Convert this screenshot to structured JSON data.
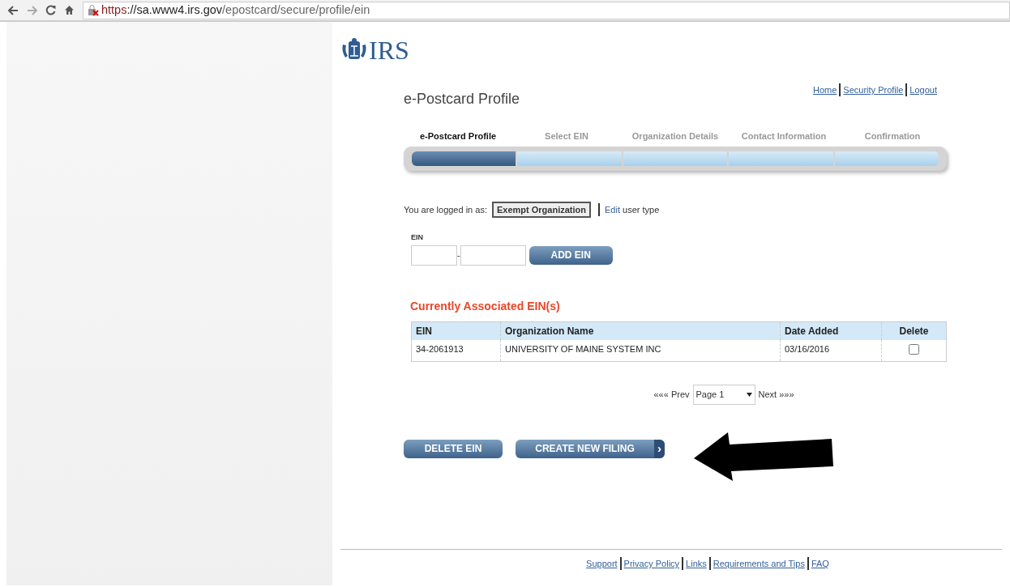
{
  "browser": {
    "url_scheme": "https",
    "url_host": "://sa.www4.irs.gov",
    "url_path": "/epostcard/secure/profile/ein",
    "insecure": true
  },
  "logo": {
    "text": "IRS"
  },
  "page_title": "e-Postcard Profile",
  "top_links": [
    "Home",
    "Security Profile",
    "Logout"
  ],
  "steps": [
    {
      "label": "e-Postcard Profile",
      "selected": true
    },
    {
      "label": "Select EIN",
      "selected": false
    },
    {
      "label": "Organization Details",
      "selected": false
    },
    {
      "label": "Contact Information",
      "selected": false
    },
    {
      "label": "Confirmation",
      "selected": false
    }
  ],
  "login": {
    "prefix": "You are logged in as:",
    "user_type": "Exempt Organization",
    "edit_link": "Edit",
    "edit_rest": "user type"
  },
  "ein_form": {
    "label": "EIN",
    "separator": "-",
    "button": "ADD EIN"
  },
  "associated": {
    "heading": "Currently Associated EIN(s)",
    "columns": [
      "EIN",
      "Organization Name",
      "Date Added",
      "Delete"
    ],
    "rows": [
      {
        "ein": "34-2061913",
        "name": "UNIVERSITY OF MAINE SYSTEM INC",
        "date": "03/16/2016",
        "checked": false
      }
    ]
  },
  "pager": {
    "prev": "««« Prev",
    "page": "Page 1",
    "next": "Next »»»"
  },
  "actions": {
    "delete": "DELETE EIN",
    "create": "CREATE NEW FILING",
    "create_chevron": "›"
  },
  "footer_links": [
    "Support",
    "Privacy Policy",
    "Links",
    "Requirements and Tips",
    "FAQ"
  ]
}
